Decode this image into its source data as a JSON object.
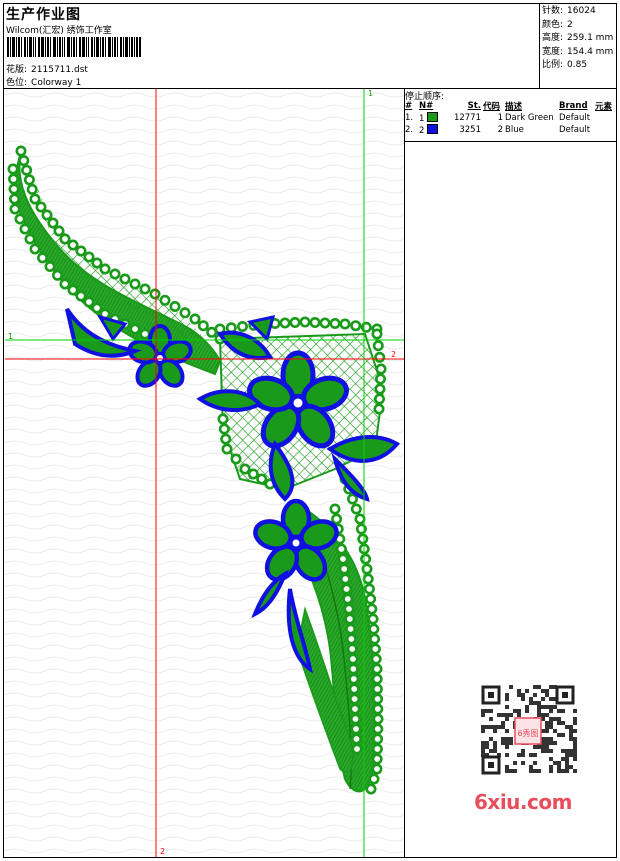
{
  "header": {
    "title": "生产作业图",
    "company": "Wilcom(汇宏) 绣饰工作室",
    "design_label": "花版:",
    "design_file": "2115711.dst",
    "colorway_label": "色位:",
    "colorway": "Colorway 1"
  },
  "stats": [
    {
      "label": "针数:",
      "value": "16024"
    },
    {
      "label": "颜色:",
      "value": "2"
    },
    {
      "label": "高度:",
      "value": "259.1 mm"
    },
    {
      "label": "宽度:",
      "value": "154.4 mm"
    },
    {
      "label": "比例:",
      "value": "0.85"
    }
  ],
  "stop_sequence": {
    "title": "停止顺序:",
    "headers": [
      "#",
      "N#",
      "St.",
      "代码",
      "描述",
      "Brand",
      "元素"
    ],
    "rows": [
      {
        "num": "1.",
        "n": "1",
        "color": "#1a9a1a",
        "stitches": "12771",
        "code": "1",
        "desc": "Dark Green",
        "brand": "Default",
        "element": ""
      },
      {
        "num": "2.",
        "n": "2",
        "color": "#1010e0",
        "stitches": "3251",
        "code": "2",
        "desc": "Blue",
        "brand": "Default",
        "element": ""
      }
    ]
  },
  "guides": {
    "v1_label": "1",
    "h1_label": "1",
    "h2_label": "2",
    "v2_label": "2"
  },
  "watermark": {
    "text": "6xiu.com",
    "qr_text": "6秀图"
  },
  "colors": {
    "green": "#1a9a1a",
    "blue": "#1010e0",
    "guide_red": "#ff0000",
    "guide_green": "#00d000"
  }
}
